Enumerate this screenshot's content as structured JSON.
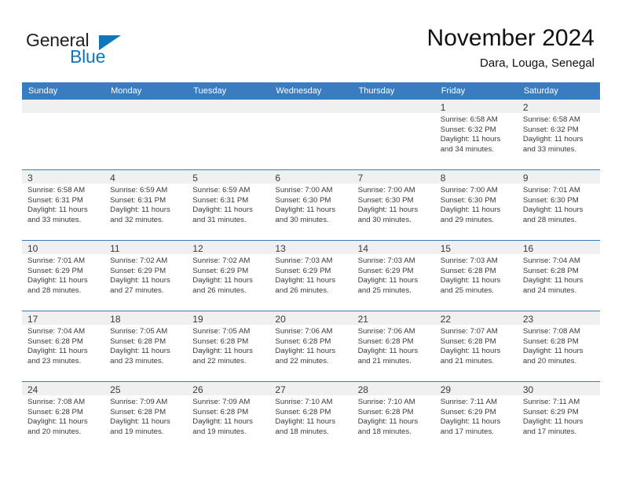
{
  "brand": {
    "name_part1": "General",
    "name_part2": "Blue",
    "accent_color": "#0f76bc"
  },
  "header": {
    "title": "November 2024",
    "subtitle": "Dara, Louga, Senegal"
  },
  "calendar": {
    "header_color": "#3a7cc0",
    "weekday_headers": [
      "Sunday",
      "Monday",
      "Tuesday",
      "Wednesday",
      "Thursday",
      "Friday",
      "Saturday"
    ],
    "weeks": [
      [
        {
          "day": "",
          "sunrise": "",
          "sunset": "",
          "daylight1": "",
          "daylight2": "",
          "empty": true
        },
        {
          "day": "",
          "sunrise": "",
          "sunset": "",
          "daylight1": "",
          "daylight2": "",
          "empty": true
        },
        {
          "day": "",
          "sunrise": "",
          "sunset": "",
          "daylight1": "",
          "daylight2": "",
          "empty": true
        },
        {
          "day": "",
          "sunrise": "",
          "sunset": "",
          "daylight1": "",
          "daylight2": "",
          "empty": true
        },
        {
          "day": "",
          "sunrise": "",
          "sunset": "",
          "daylight1": "",
          "daylight2": "",
          "empty": true
        },
        {
          "day": "1",
          "sunrise": "Sunrise: 6:58 AM",
          "sunset": "Sunset: 6:32 PM",
          "daylight1": "Daylight: 11 hours",
          "daylight2": "and 34 minutes."
        },
        {
          "day": "2",
          "sunrise": "Sunrise: 6:58 AM",
          "sunset": "Sunset: 6:32 PM",
          "daylight1": "Daylight: 11 hours",
          "daylight2": "and 33 minutes."
        }
      ],
      [
        {
          "day": "3",
          "sunrise": "Sunrise: 6:58 AM",
          "sunset": "Sunset: 6:31 PM",
          "daylight1": "Daylight: 11 hours",
          "daylight2": "and 33 minutes."
        },
        {
          "day": "4",
          "sunrise": "Sunrise: 6:59 AM",
          "sunset": "Sunset: 6:31 PM",
          "daylight1": "Daylight: 11 hours",
          "daylight2": "and 32 minutes."
        },
        {
          "day": "5",
          "sunrise": "Sunrise: 6:59 AM",
          "sunset": "Sunset: 6:31 PM",
          "daylight1": "Daylight: 11 hours",
          "daylight2": "and 31 minutes."
        },
        {
          "day": "6",
          "sunrise": "Sunrise: 7:00 AM",
          "sunset": "Sunset: 6:30 PM",
          "daylight1": "Daylight: 11 hours",
          "daylight2": "and 30 minutes."
        },
        {
          "day": "7",
          "sunrise": "Sunrise: 7:00 AM",
          "sunset": "Sunset: 6:30 PM",
          "daylight1": "Daylight: 11 hours",
          "daylight2": "and 30 minutes."
        },
        {
          "day": "8",
          "sunrise": "Sunrise: 7:00 AM",
          "sunset": "Sunset: 6:30 PM",
          "daylight1": "Daylight: 11 hours",
          "daylight2": "and 29 minutes."
        },
        {
          "day": "9",
          "sunrise": "Sunrise: 7:01 AM",
          "sunset": "Sunset: 6:30 PM",
          "daylight1": "Daylight: 11 hours",
          "daylight2": "and 28 minutes."
        }
      ],
      [
        {
          "day": "10",
          "sunrise": "Sunrise: 7:01 AM",
          "sunset": "Sunset: 6:29 PM",
          "daylight1": "Daylight: 11 hours",
          "daylight2": "and 28 minutes."
        },
        {
          "day": "11",
          "sunrise": "Sunrise: 7:02 AM",
          "sunset": "Sunset: 6:29 PM",
          "daylight1": "Daylight: 11 hours",
          "daylight2": "and 27 minutes."
        },
        {
          "day": "12",
          "sunrise": "Sunrise: 7:02 AM",
          "sunset": "Sunset: 6:29 PM",
          "daylight1": "Daylight: 11 hours",
          "daylight2": "and 26 minutes."
        },
        {
          "day": "13",
          "sunrise": "Sunrise: 7:03 AM",
          "sunset": "Sunset: 6:29 PM",
          "daylight1": "Daylight: 11 hours",
          "daylight2": "and 26 minutes."
        },
        {
          "day": "14",
          "sunrise": "Sunrise: 7:03 AM",
          "sunset": "Sunset: 6:29 PM",
          "daylight1": "Daylight: 11 hours",
          "daylight2": "and 25 minutes."
        },
        {
          "day": "15",
          "sunrise": "Sunrise: 7:03 AM",
          "sunset": "Sunset: 6:28 PM",
          "daylight1": "Daylight: 11 hours",
          "daylight2": "and 25 minutes."
        },
        {
          "day": "16",
          "sunrise": "Sunrise: 7:04 AM",
          "sunset": "Sunset: 6:28 PM",
          "daylight1": "Daylight: 11 hours",
          "daylight2": "and 24 minutes."
        }
      ],
      [
        {
          "day": "17",
          "sunrise": "Sunrise: 7:04 AM",
          "sunset": "Sunset: 6:28 PM",
          "daylight1": "Daylight: 11 hours",
          "daylight2": "and 23 minutes."
        },
        {
          "day": "18",
          "sunrise": "Sunrise: 7:05 AM",
          "sunset": "Sunset: 6:28 PM",
          "daylight1": "Daylight: 11 hours",
          "daylight2": "and 23 minutes."
        },
        {
          "day": "19",
          "sunrise": "Sunrise: 7:05 AM",
          "sunset": "Sunset: 6:28 PM",
          "daylight1": "Daylight: 11 hours",
          "daylight2": "and 22 minutes."
        },
        {
          "day": "20",
          "sunrise": "Sunrise: 7:06 AM",
          "sunset": "Sunset: 6:28 PM",
          "daylight1": "Daylight: 11 hours",
          "daylight2": "and 22 minutes."
        },
        {
          "day": "21",
          "sunrise": "Sunrise: 7:06 AM",
          "sunset": "Sunset: 6:28 PM",
          "daylight1": "Daylight: 11 hours",
          "daylight2": "and 21 minutes."
        },
        {
          "day": "22",
          "sunrise": "Sunrise: 7:07 AM",
          "sunset": "Sunset: 6:28 PM",
          "daylight1": "Daylight: 11 hours",
          "daylight2": "and 21 minutes."
        },
        {
          "day": "23",
          "sunrise": "Sunrise: 7:08 AM",
          "sunset": "Sunset: 6:28 PM",
          "daylight1": "Daylight: 11 hours",
          "daylight2": "and 20 minutes."
        }
      ],
      [
        {
          "day": "24",
          "sunrise": "Sunrise: 7:08 AM",
          "sunset": "Sunset: 6:28 PM",
          "daylight1": "Daylight: 11 hours",
          "daylight2": "and 20 minutes."
        },
        {
          "day": "25",
          "sunrise": "Sunrise: 7:09 AM",
          "sunset": "Sunset: 6:28 PM",
          "daylight1": "Daylight: 11 hours",
          "daylight2": "and 19 minutes."
        },
        {
          "day": "26",
          "sunrise": "Sunrise: 7:09 AM",
          "sunset": "Sunset: 6:28 PM",
          "daylight1": "Daylight: 11 hours",
          "daylight2": "and 19 minutes."
        },
        {
          "day": "27",
          "sunrise": "Sunrise: 7:10 AM",
          "sunset": "Sunset: 6:28 PM",
          "daylight1": "Daylight: 11 hours",
          "daylight2": "and 18 minutes."
        },
        {
          "day": "28",
          "sunrise": "Sunrise: 7:10 AM",
          "sunset": "Sunset: 6:28 PM",
          "daylight1": "Daylight: 11 hours",
          "daylight2": "and 18 minutes."
        },
        {
          "day": "29",
          "sunrise": "Sunrise: 7:11 AM",
          "sunset": "Sunset: 6:29 PM",
          "daylight1": "Daylight: 11 hours",
          "daylight2": "and 17 minutes."
        },
        {
          "day": "30",
          "sunrise": "Sunrise: 7:11 AM",
          "sunset": "Sunset: 6:29 PM",
          "daylight1": "Daylight: 11 hours",
          "daylight2": "and 17 minutes."
        }
      ]
    ]
  }
}
